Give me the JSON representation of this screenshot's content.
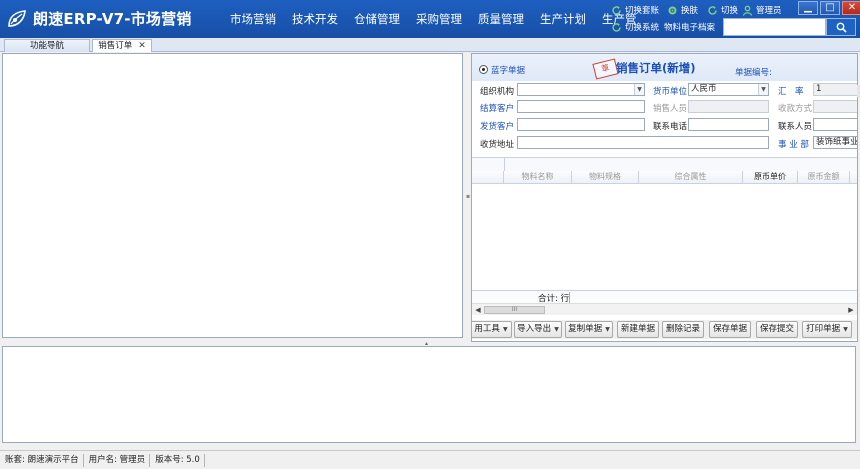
{
  "app": {
    "title": "朗速ERP-V7-市场营销",
    "logo_icon": "leaf-logo-icon"
  },
  "menu": [
    "市场营销",
    "技术开发",
    "仓储管理",
    "采购管理",
    "质量管理",
    "生产计划",
    "生产管"
  ],
  "quick": {
    "switch_set": "切换套账",
    "skin": "换肤",
    "switch": "切换",
    "admin": "管理员",
    "switch_system": "切换系统",
    "material_archive": "物料电子档案"
  },
  "window_buttons": {
    "minimize": "▁",
    "maximize": "□",
    "close": "✕"
  },
  "search": {
    "value": "",
    "placeholder": ""
  },
  "tabs": [
    {
      "label": "功能导航"
    },
    {
      "label": "销售订单",
      "close": "✕"
    }
  ],
  "form": {
    "radio_label": "蓝字单据",
    "stamp": "草",
    "title": "销售订单(新增)",
    "doc_no_label": "单据编号:",
    "rows": {
      "org_label": "组织机构",
      "currency_label": "货币单位",
      "currency_value": "人民币",
      "rate_label": "汇　率",
      "rate_value": "1",
      "settle_customer_label": "结算客户",
      "salesperson_label": "销售人员",
      "payment_method_label": "收款方式",
      "ship_customer_label": "发货客户",
      "contact_phone_label": "联系电话",
      "contact_person_label": "联系人员",
      "address_label": "收货地址",
      "division_label": "事 业 部",
      "division_value": "装饰纸事业"
    }
  },
  "grid": {
    "columns": [
      "物料名称",
      "物料规格",
      "综合属性",
      "原币单价",
      "原币金额"
    ],
    "total_label": "合计: 行",
    "scroll_thumb": "III"
  },
  "toolbar": [
    {
      "label": "用工具",
      "dropdown": true
    },
    {
      "label": "导入导出",
      "dropdown": true
    },
    {
      "label": "复制单据",
      "dropdown": true
    },
    {
      "label": "新建单据",
      "dropdown": false
    },
    {
      "label": "删除记录",
      "dropdown": false
    },
    {
      "label": "保存单据",
      "dropdown": false
    },
    {
      "label": "保存提交",
      "dropdown": false
    },
    {
      "label": "打印单据",
      "dropdown": true
    }
  ],
  "status": {
    "account_label": "账套:",
    "account_value": "朗速演示平台",
    "user_label": "用户名:",
    "user_value": "管理员",
    "version_label": "版本号:",
    "version_value": "5.0"
  },
  "colors": {
    "title_bar": "#1e5fc0",
    "label_blue": "#1a4fb8",
    "stamp_red": "#d23a2e"
  }
}
